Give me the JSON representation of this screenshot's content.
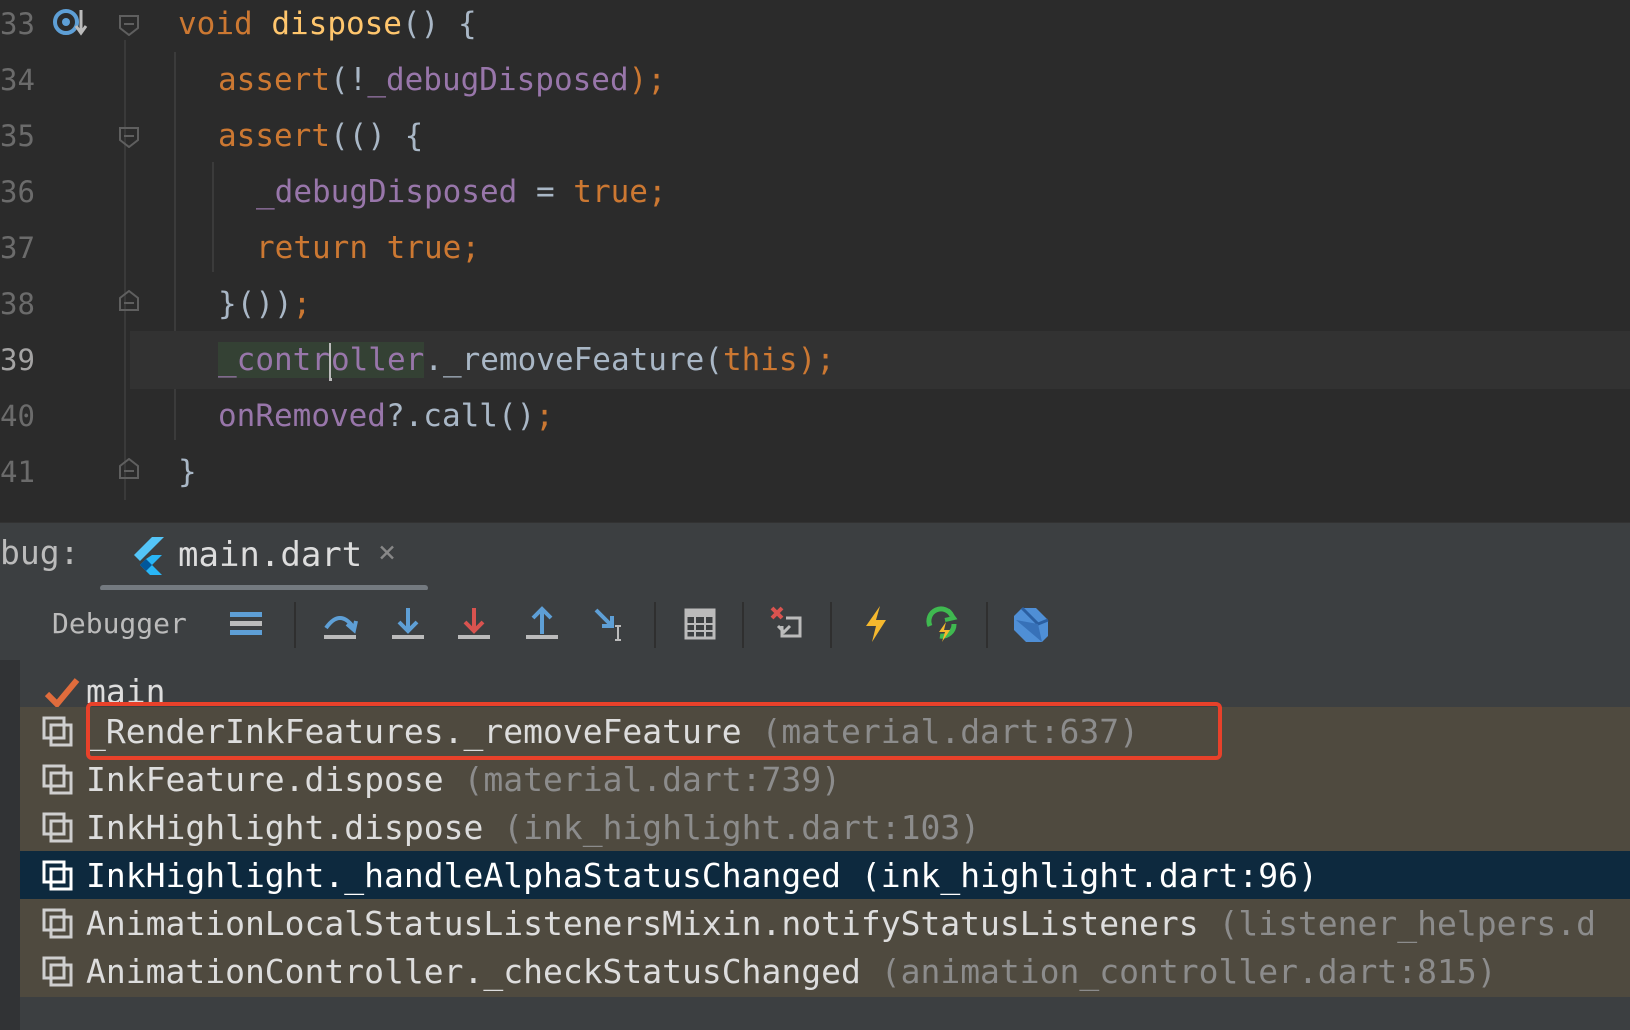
{
  "editor": {
    "lines": [
      {
        "num": "33",
        "tokens": [
          {
            "t": "void ",
            "c": "kw"
          },
          {
            "t": "dispose",
            "c": "fn"
          },
          {
            "t": "() {",
            "c": "plain"
          }
        ]
      },
      {
        "num": "34",
        "tokens": [
          {
            "t": "assert",
            "c": "kw"
          },
          {
            "t": "(!",
            "c": "plain"
          },
          {
            "t": "_debugDisposed",
            "c": "field"
          },
          {
            "t": ");",
            "c": "kw"
          }
        ]
      },
      {
        "num": "35",
        "tokens": [
          {
            "t": "assert",
            "c": "kw"
          },
          {
            "t": "(() {",
            "c": "plain"
          }
        ]
      },
      {
        "num": "36",
        "tokens": [
          {
            "t": "_debugDisposed",
            "c": "field"
          },
          {
            "t": " = ",
            "c": "plain"
          },
          {
            "t": "true",
            "c": "kw"
          },
          {
            "t": ";",
            "c": "kw"
          }
        ]
      },
      {
        "num": "37",
        "tokens": [
          {
            "t": "return true",
            "c": "kw"
          },
          {
            "t": ";",
            "c": "kw"
          }
        ]
      },
      {
        "num": "38",
        "tokens": [
          {
            "t": "}())",
            "c": "plain"
          },
          {
            "t": ";",
            "c": "kw"
          }
        ]
      },
      {
        "num": "39",
        "tokens": [
          {
            "t": "_contr",
            "c": "field"
          },
          {
            "t": "oller",
            "c": "field"
          },
          {
            "t": "._removeFeature(",
            "c": "plain"
          },
          {
            "t": "this",
            "c": "kw"
          },
          {
            "t": ");",
            "c": "kw"
          }
        ]
      },
      {
        "num": "40",
        "tokens": [
          {
            "t": "onRemoved",
            "c": "field"
          },
          {
            "t": "?.call()",
            "c": "plain"
          },
          {
            "t": ";",
            "c": "kw"
          }
        ]
      },
      {
        "num": "41",
        "tokens": [
          {
            "t": "}",
            "c": "plain"
          }
        ]
      }
    ]
  },
  "debug": {
    "label": "bug:",
    "tab_title": "main.dart",
    "tab_close": "×",
    "toolbar_label": "Debugger"
  },
  "threads": {
    "name": "main"
  },
  "frames": [
    {
      "method": "_RenderInkFeatures._removeFeature",
      "location": "(material.dart:637)"
    },
    {
      "method": "InkFeature.dispose",
      "location": "(material.dart:739)"
    },
    {
      "method": "InkHighlight.dispose",
      "location": "(ink_highlight.dart:103)"
    },
    {
      "method": "InkHighlight._handleAlphaStatusChanged",
      "location": "(ink_highlight.dart:96)"
    },
    {
      "method": "AnimationLocalStatusListenersMixin.notifyStatusListeners",
      "location": "(listener_helpers.d"
    },
    {
      "method": "AnimationController._checkStatusChanged",
      "location": "(animation_controller.dart:815)"
    }
  ],
  "colors": {
    "keyword": "#cc7832",
    "function": "#ffc66d",
    "field": "#9876aa",
    "selection": "#0d293e",
    "highlight_box": "#e8412a"
  }
}
